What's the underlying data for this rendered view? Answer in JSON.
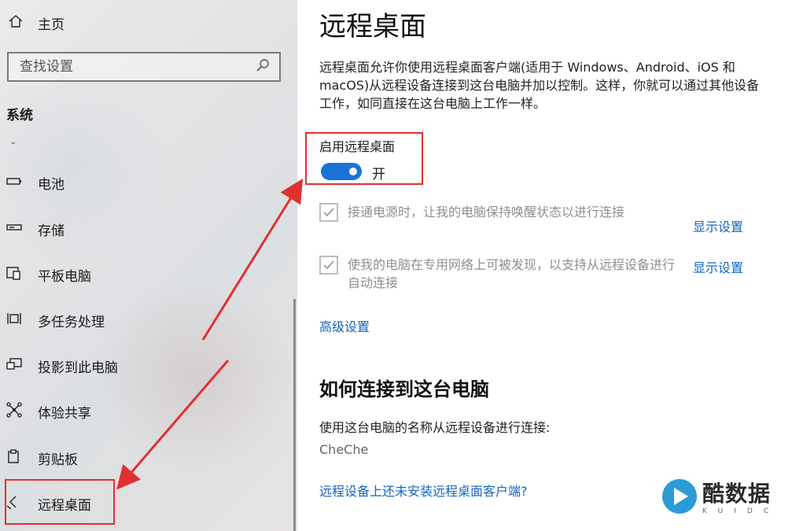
{
  "sidebar": {
    "home_label": "主页",
    "search_placeholder": "查找设置",
    "section_title": "系统",
    "dash": "-",
    "items": [
      {
        "label": "电池",
        "icon": "battery-icon"
      },
      {
        "label": "存储",
        "icon": "storage-icon"
      },
      {
        "label": "平板电脑",
        "icon": "tablet-icon"
      },
      {
        "label": "多任务处理",
        "icon": "multitasking-icon"
      },
      {
        "label": "投影到此电脑",
        "icon": "projection-icon"
      },
      {
        "label": "体验共享",
        "icon": "shared-experiences-icon"
      },
      {
        "label": "剪贴板",
        "icon": "clipboard-icon"
      },
      {
        "label": "远程桌面",
        "icon": "remote-desktop-icon"
      }
    ]
  },
  "main": {
    "title": "远程桌面",
    "description": "远程桌面允许你使用远程桌面客户端(适用于 Windows、Android、iOS 和 macOS)从远程设备连接到这台电脑并加以控制。这样，你就可以通过其他设备工作，如同直接在这台电脑上工作一样。",
    "enable_label": "启用远程桌面",
    "toggle_state": "开",
    "toggle_on": true,
    "options": [
      {
        "text": "接通电源时，让我的电脑保持唤醒状态以进行连接",
        "link": "显示设置",
        "checked": true
      },
      {
        "text": "使我的电脑在专用网络上可被发现，以支持从远程设备进行自动连接",
        "link": "显示设置",
        "checked": true
      }
    ],
    "advanced_link": "高级设置",
    "how_to_title": "如何连接到这台电脑",
    "connect_instruction": "使用这台电脑的名称从远程设备进行连接:",
    "pc_name": "CheChe",
    "client_link": "远程设备上还未安装远程桌面客户端?"
  },
  "watermark": {
    "text": "酷数据",
    "sub": "KUIDC"
  },
  "colors": {
    "accent": "#1a73d9",
    "link": "#1565c0",
    "highlight": "#e03030"
  }
}
